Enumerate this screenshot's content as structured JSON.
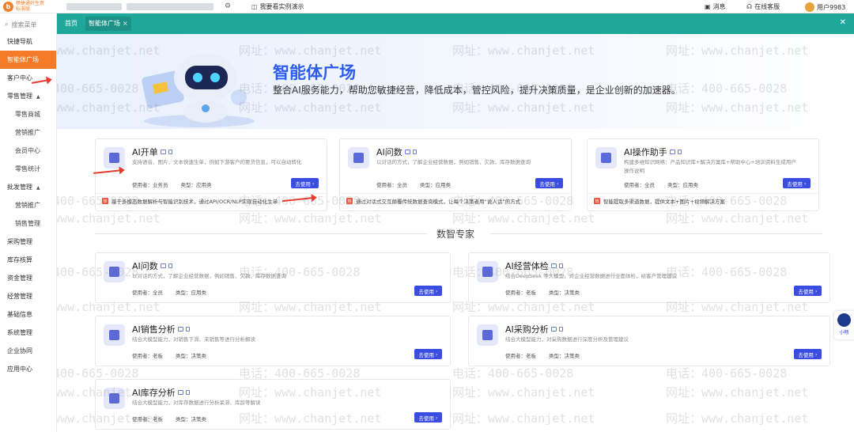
{
  "app": {
    "logo_name": "畅捷通好生意",
    "edition": "标准版"
  },
  "topbar": {
    "demo_label": "我要看实例演示",
    "messages": "消息",
    "support": "在线客服",
    "user": "用户9983"
  },
  "sidebar": {
    "search_placeholder": "搜索菜单",
    "items": [
      {
        "label": "快捷导航",
        "level": 0
      },
      {
        "label": "智能体广场",
        "level": 0,
        "active": true
      },
      {
        "label": "客户中心",
        "level": 0
      },
      {
        "label": "零售管理",
        "level": 0,
        "expanded": true
      },
      {
        "label": "零售商城",
        "level": 1
      },
      {
        "label": "营销推广",
        "level": 1
      },
      {
        "label": "会员中心",
        "level": 1
      },
      {
        "label": "零售统计",
        "level": 1
      },
      {
        "label": "批发管理",
        "level": 0,
        "expanded": true
      },
      {
        "label": "营销推广",
        "level": 1
      },
      {
        "label": "销售管理",
        "level": 1
      },
      {
        "label": "采购管理",
        "level": 0
      },
      {
        "label": "库存核算",
        "level": 0
      },
      {
        "label": "资金管理",
        "level": 0
      },
      {
        "label": "经营管理",
        "level": 0
      },
      {
        "label": "基础信息",
        "level": 0
      },
      {
        "label": "系统管理",
        "level": 0
      },
      {
        "label": "企业协同",
        "level": 0
      },
      {
        "label": "应用中心",
        "level": 0
      }
    ]
  },
  "tabs": [
    {
      "label": "首页"
    },
    {
      "label": "智能体广场",
      "closable": true
    }
  ],
  "banner": {
    "title": "智能体广场",
    "subtitle": "整合AI服务能力，帮助您敏捷经营，降低成本，管控风险，提升决策质量，是企业创新的加速器。"
  },
  "featured": [
    {
      "title": "AI开单",
      "desc": "支持语音、图片、文本快速生单，例如下游客户的要货信息，可以自动转化",
      "user": "使用者：业务员",
      "type": "类型：应用类",
      "button": "去使用",
      "foot": "基于多模态数据解析与智能识别技术，通过API/OCR/NLP实现自动化生单"
    },
    {
      "title": "AI问数",
      "desc": "以对话的方式，了解企业经营数据，例如销售、欠款、库存数据查询",
      "user": "使用者：全员",
      "type": "类型：应用类",
      "button": "去使用",
      "foot": "通过对话式交互颠覆传统数据查询模式，让每个决策者用“说人话”的方式"
    },
    {
      "title": "AI操作助手",
      "desc": "构建多维知识网络：产品知识库+解决方案库+帮助中心+培训资料生成用户操作说明",
      "user": "使用者：全员",
      "type": "类型：应用类",
      "button": "去使用",
      "foot": "智能提取多渠道数据，提供文本+图片+视频解决方案"
    }
  ],
  "section_title": "数智专家",
  "experts": [
    {
      "title": "AI问数",
      "desc": "以对话的方式，了解企业经营数据，例如销售、欠款、库存数据查询",
      "user": "使用者：全员",
      "type": "类型：应用类",
      "button": "去使用"
    },
    {
      "title": "AI经营体检",
      "desc": "结合DeepSeek 等大模型，对企业经营数据进行全面体检，给客户管理建议",
      "user": "使用者：老板",
      "type": "类型：决策类",
      "button": "去使用"
    },
    {
      "title": "AI销售分析",
      "desc": "结合大模型能力，对销售下滑、未销售等进行分析解读",
      "user": "使用者：老板",
      "type": "类型：决策类",
      "button": "去使用"
    },
    {
      "title": "AI采购分析",
      "desc": "结合大模型能力，对采购数据进行深度分析及管理建议",
      "user": "使用者：老板",
      "type": "类型：决策类",
      "button": "去使用"
    },
    {
      "title": "AI库存分析",
      "desc": "结合大模型能力，对库存数据进行分析呆滞、库龄等解读",
      "user": "使用者：老板",
      "type": "类型：决策类",
      "button": "去使用"
    }
  ],
  "watermark": {
    "phone": "电话：400-665-0028",
    "site": "网址：www.chanjet.net"
  },
  "float_widget": {
    "label": "小畅"
  }
}
